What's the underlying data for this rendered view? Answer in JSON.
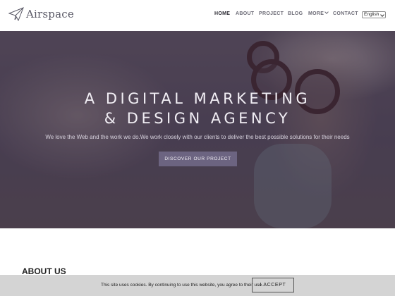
{
  "brand": {
    "name": "Airspace",
    "logo_icon": "paper-plane-icon"
  },
  "nav": {
    "items": [
      {
        "label": "HOME",
        "active": true
      },
      {
        "label": "ABOUT",
        "active": false
      },
      {
        "label": "PROJECT",
        "active": false
      },
      {
        "label": "BLOG",
        "active": false
      },
      {
        "label": "MORE",
        "active": false,
        "has_dropdown": true
      },
      {
        "label": "CONTACT",
        "active": false
      }
    ],
    "language": "English"
  },
  "hero": {
    "title_line1": "A DIGITAL MARKETING",
    "title_line2": "& DESIGN AGENCY",
    "subtitle": "We love the Web and the work we do.We work closely with our clients to deliver the best possible solutions for their needs",
    "cta_label": "DISCOVER OUR PROJECT"
  },
  "about": {
    "heading": "ABOUT US"
  },
  "cookie": {
    "text": "This site uses cookies. By continuing to use this website, you agree to their use.",
    "button_label": "I ACCEPT"
  },
  "colors": {
    "accent": "#6c6481",
    "nav_text": "#6b6a75",
    "nav_active": "#2b2a33",
    "hero_overlay": "#3a3048"
  }
}
